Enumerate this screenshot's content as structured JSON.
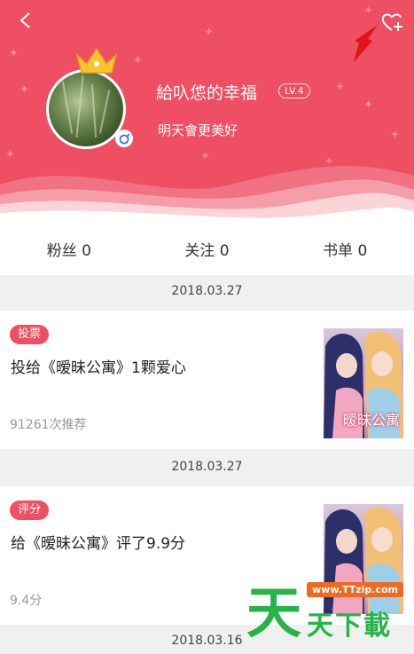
{
  "header": {
    "username": "給叺怹的幸福",
    "level": "LV.4",
    "signature": "明天會更美好",
    "colors": {
      "accent": "#ee4f62"
    }
  },
  "stats": [
    {
      "label": "粉丝 0"
    },
    {
      "label": "关注 0"
    },
    {
      "label": "书单 0"
    }
  ],
  "feed": [
    {
      "date": "2018.03.27",
      "tag": "投票",
      "title": "投给《暧昧公寓》1颗爱心",
      "meta": "91261次推荐",
      "cover_text": "暧昧公寓"
    },
    {
      "date": "2018.03.27",
      "tag": "评分",
      "title": "给《暧昧公寓》评了9.9分",
      "meta": "9.4分"
    }
  ],
  "next_date": "2018.03.16",
  "watermark": {
    "url": "www.TTzip.com",
    "big": "天",
    "small": "天下載"
  }
}
